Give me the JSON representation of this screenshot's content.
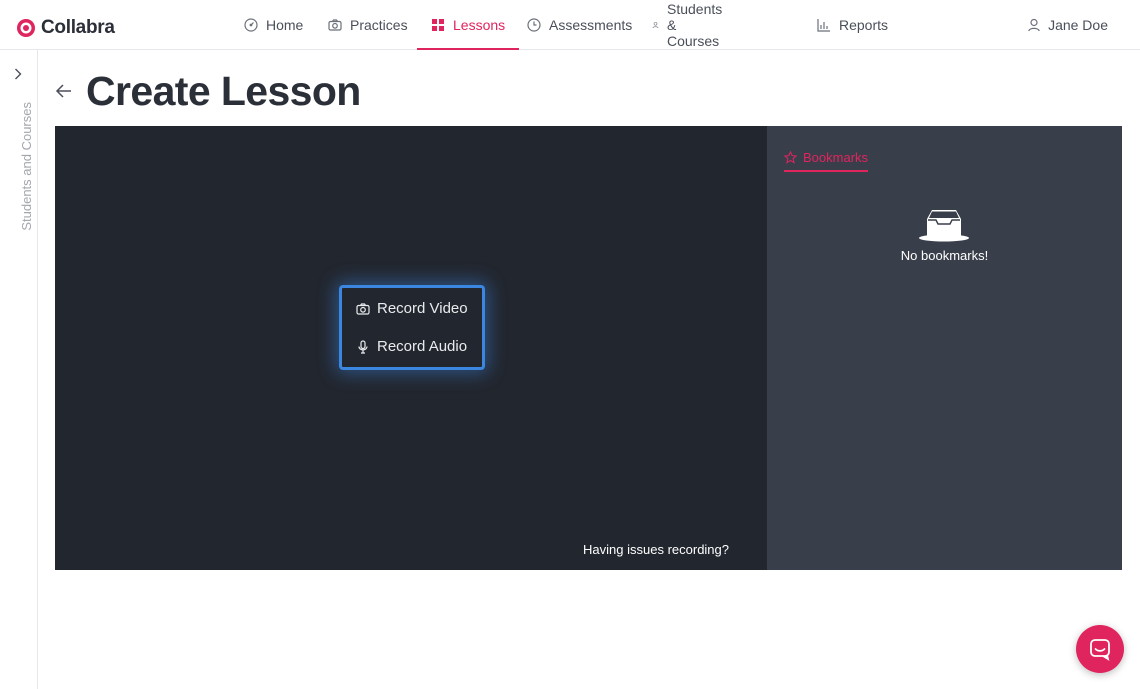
{
  "app": {
    "name": "Collabra",
    "brand_color": "#e0245e"
  },
  "nav": {
    "items": [
      {
        "label": "Home",
        "icon": "dashboard-icon",
        "active": false
      },
      {
        "label": "Practices",
        "icon": "camera-icon",
        "active": false
      },
      {
        "label": "Lessons",
        "icon": "grid-icon",
        "active": true
      },
      {
        "label": "Assessments",
        "icon": "clock-icon",
        "active": false
      },
      {
        "label": "Students & Courses",
        "icon": "person-icon",
        "active": false
      },
      {
        "label": "Reports",
        "icon": "bar-chart-icon",
        "active": false
      }
    ],
    "user": "Jane Doe"
  },
  "sidebar": {
    "label": "Students and Courses"
  },
  "page": {
    "title": "Create Lesson"
  },
  "recorder": {
    "video_label": "Record Video",
    "audio_label": "Record Audio",
    "issues_link": "Having issues recording?",
    "accent": "#3b86e0"
  },
  "bookmarks": {
    "tab_label": "Bookmarks",
    "empty_text": "No bookmarks!"
  }
}
